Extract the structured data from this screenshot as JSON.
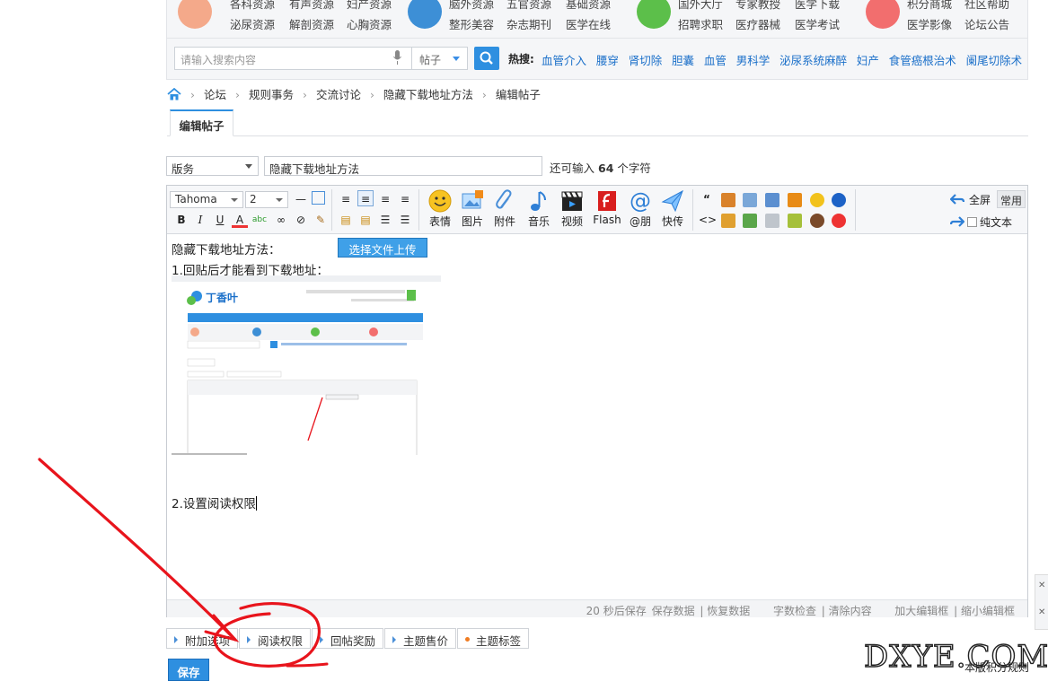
{
  "nav_groups": [
    {
      "color": "#f4a98a",
      "row1": [
        "各科资源",
        "有声资源",
        "妇产资源"
      ],
      "row2": [
        "泌尿资源",
        "解剖资源",
        "心胸资源"
      ]
    },
    {
      "color": "#3d8fd6",
      "row1": [
        "脑外资源",
        "五官资源",
        "基础资源"
      ],
      "row2": [
        "整形美容",
        "杂志期刊",
        "医学在线"
      ]
    },
    {
      "color": "#5cbf4a",
      "row1": [
        "国外大厅",
        "专家教授",
        "医学下载"
      ],
      "row2": [
        "招聘求职",
        "医疗器械",
        "医学考试"
      ]
    },
    {
      "color": "#f26e6e",
      "row1": [
        "积分商城",
        "社区帮助"
      ],
      "row2": [
        "医学影像",
        "论坛公告"
      ]
    }
  ],
  "search": {
    "placeholder": "请输入搜索内容",
    "scope": "帖子",
    "hot_label": "热搜:",
    "hot_terms": [
      "血管介入",
      "腰穿",
      "肾切除",
      "胆囊",
      "血管",
      "男科学",
      "泌尿系统麻醉",
      "妇产",
      "食管癌根治术",
      "阑尾切除术"
    ]
  },
  "breadcrumb": [
    "论坛",
    "规则事务",
    "交流讨论",
    "隐藏下载地址方法",
    "编辑帖子"
  ],
  "tab_label": "编辑帖子",
  "form": {
    "category": "版务",
    "title": "隐藏下载地址方法",
    "remain_prefix": "还可输入",
    "remain_count": "64",
    "remain_suffix": "个字符"
  },
  "toolbar": {
    "font": "Tahoma",
    "size": "2",
    "big_buttons": [
      "表情",
      "图片",
      "附件",
      "音乐",
      "视频",
      "Flash",
      "@朋",
      "快传"
    ],
    "fullscreen": "全屏",
    "common": "常用",
    "plain_text": "纯文本"
  },
  "content": {
    "line1": "隐藏下载地址方法：",
    "upload_button": "选择文件上传",
    "line2": "1.回贴后才能看到下载地址：",
    "line3": "2.设置阅读权限"
  },
  "statusbar": {
    "autosave": "20 秒后保存",
    "save": "保存数据",
    "restore": "恢复数据",
    "count": "字数检查",
    "clear": "清除内容",
    "enlarge": "加大编辑框",
    "shrink": "缩小编辑框"
  },
  "options": [
    "附加选项",
    "阅读权限",
    "回帖奖励",
    "主题售价",
    "主题标签"
  ],
  "save_label": "保存",
  "watermark": "DXYE.COM",
  "corner_text": "本版积分规则",
  "thumb": {
    "logo": "丁香叶"
  },
  "colors": {
    "accent": "#2e8fe0",
    "annotation": "#e8141c"
  }
}
